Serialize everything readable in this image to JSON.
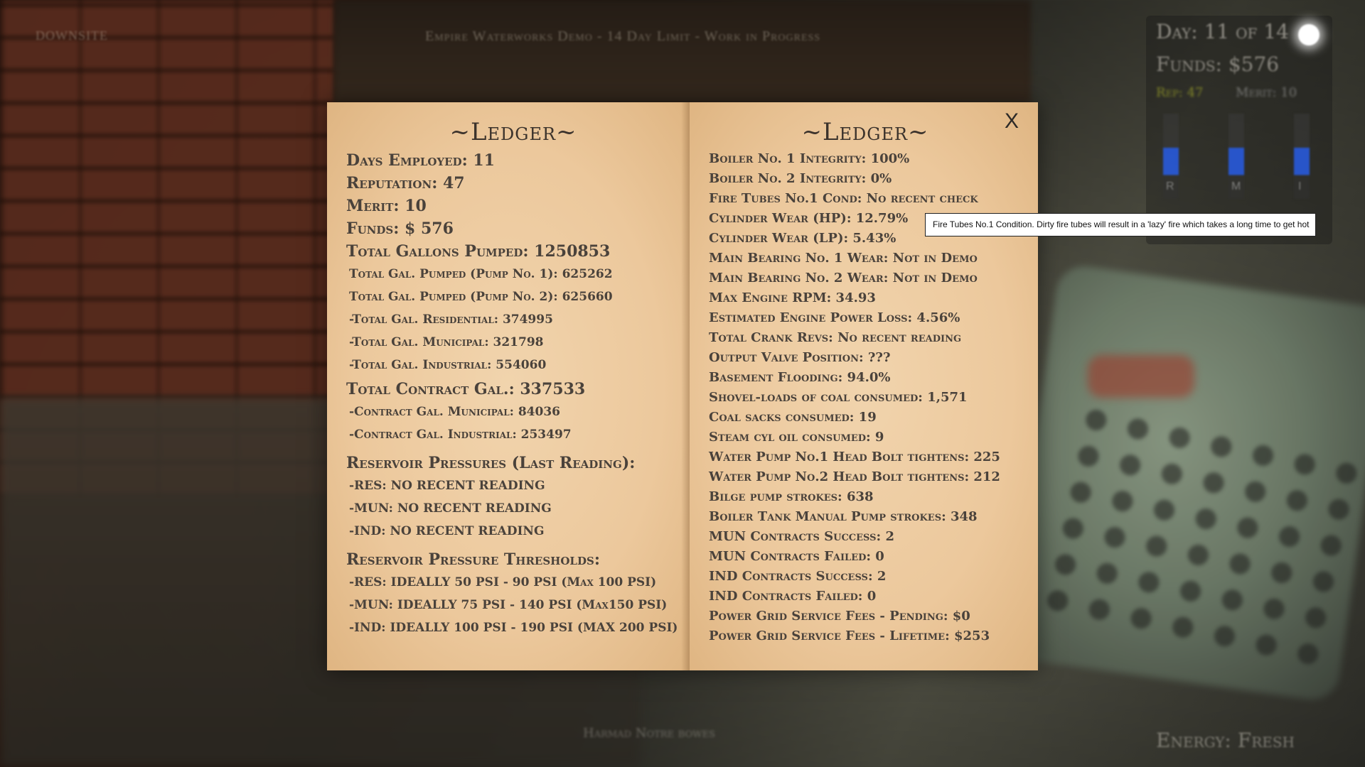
{
  "hud": {
    "top_left": "DOWNSITE",
    "top_center": "Empire Waterworks Demo - 14 Day Limit - Work in Progress",
    "day": "Day: 11 of 14",
    "funds": "Funds: $576",
    "rep": "Rep: 47",
    "merit": "Merit: 10",
    "gauges": [
      "R",
      "M",
      "I"
    ],
    "energy": "Energy: Fresh",
    "bottom_center": "Harmad Notre bowes"
  },
  "ledger": {
    "left_title": "~Ledger~",
    "right_title": "~Ledger~",
    "close_label": "X",
    "left": {
      "days_employed": "Days Employed: 11",
      "reputation": "Reputation: 47",
      "merit": "Merit: 10",
      "funds": "Funds: $ 576",
      "total_gallons": "Total Gallons Pumped: 1250853",
      "pump1": "Total Gal. Pumped (Pump No. 1): 625262",
      "pump2": "Total Gal. Pumped (Pump No. 2): 625660",
      "residential": "-Total Gal. Residential: 374995",
      "municipal": "-Total Gal. Municipal: 321798",
      "industrial": "-Total Gal. Industrial: 554060",
      "total_contract": "Total Contract Gal.: 337533",
      "contract_mun": "-Contract Gal. Municipal: 84036",
      "contract_ind": "-Contract Gal. Industrial: 253497",
      "pressures_heading": "Reservoir Pressures (Last Reading):",
      "pres_res": "-RES: NO RECENT READING",
      "pres_mun": "-MUN: NO RECENT READING",
      "pres_ind": "-IND: NO RECENT READING",
      "thresholds_heading": "Reservoir Pressure Thresholds:",
      "thr_res": "-RES: IDEALLY 50 PSI - 90 PSI (Max 100 PSI)",
      "thr_mun": "-MUN: IDEALLY 75 PSI - 140 PSI (Max150 PSI)",
      "thr_ind": "-IND: IDEALLY 100 PSI - 190 PSI (MAX 200 PSI)"
    },
    "right": [
      "Boiler No. 1 Integrity: 100%",
      "Boiler No. 2 Integrity: 0%",
      "Fire Tubes No.1 Cond: No recent check",
      "Cylinder Wear (HP): 12.79%",
      "Cylinder Wear (LP): 5.43%",
      "Main Bearing No. 1 Wear: Not in Demo",
      "Main Bearing No. 2 Wear: Not in Demo",
      "Max Engine RPM: 34.93",
      "Estimated Engine Power Loss: 4.56%",
      "Total Crank Revs: No recent reading",
      "Output Valve Position: ???",
      "Basement Flooding: 94.0%",
      "Shovel-loads of coal consumed: 1,571",
      "Coal sacks consumed: 19",
      "Steam cyl oil consumed: 9",
      "Water Pump No.1 Head Bolt tightens: 225",
      "Water Pump No.2 Head Bolt tightens: 212",
      "Bilge pump strokes: 638",
      "Boiler Tank Manual Pump strokes: 348",
      "MUN Contracts Success: 2",
      "MUN Contracts Failed: 0",
      "IND Contracts Success: 2",
      "IND Contracts Failed: 0",
      "Power Grid Service Fees - Pending: $0",
      "Power Grid Service Fees - Lifetime: $253"
    ]
  },
  "tooltip": {
    "text": "Fire Tubes No.1 Condition. Dirty fire tubes will result in a 'lazy' fire which takes a long time to get hot"
  }
}
